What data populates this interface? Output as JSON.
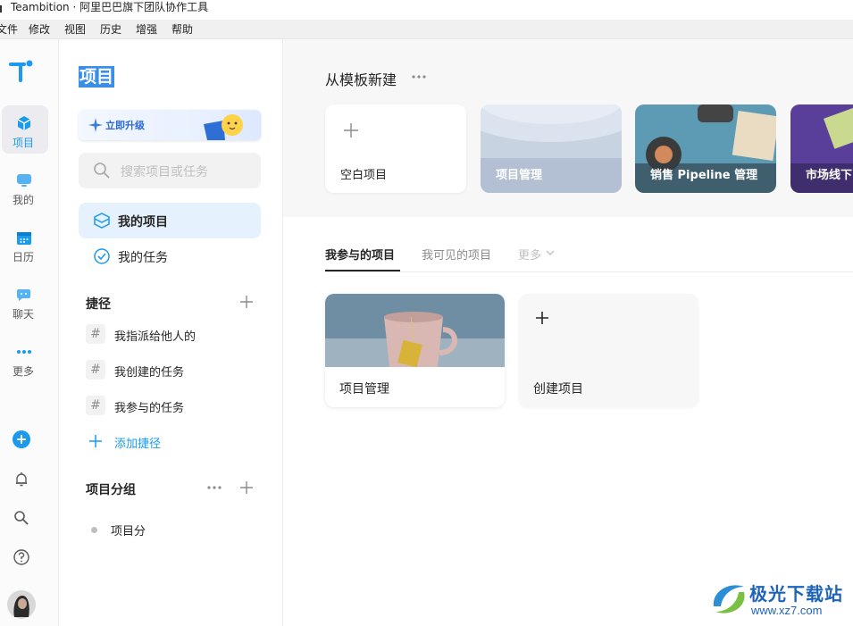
{
  "window": {
    "title": "Teambition · 阿里巴巴旗下团队协作工具"
  },
  "menu": [
    "文件",
    "修改",
    "视图",
    "历史",
    "增强",
    "帮助"
  ],
  "rail": {
    "items": [
      {
        "label": "项目",
        "icon": "project-cube-icon",
        "active": true
      },
      {
        "label": "我的",
        "icon": "my-monitor-icon"
      },
      {
        "label": "日历",
        "icon": "calendar-icon"
      },
      {
        "label": "聊天",
        "icon": "chat-bubble-icon"
      },
      {
        "label": "更多",
        "icon": "more-dots-icon"
      }
    ],
    "bottom_icons": [
      "add-icon",
      "bell-icon",
      "search-icon",
      "help-icon",
      "avatar"
    ]
  },
  "sidebar": {
    "title": "项目",
    "upgrade_label": "立即升级",
    "search_placeholder": "搜索项目或任务",
    "nav": [
      {
        "label": "我的项目",
        "active": true
      },
      {
        "label": "我的任务"
      }
    ],
    "shortcuts": {
      "heading": "捷径",
      "items": [
        "我指派给他人的",
        "我创建的任务",
        "我参与的任务"
      ],
      "add_label": "添加捷径"
    },
    "groups": {
      "heading": "项目分组",
      "items": [
        "项目分"
      ]
    }
  },
  "main": {
    "templates": {
      "heading": "从模板新建",
      "cards": [
        "空白项目",
        "项目管理",
        "销售 Pipeline 管理",
        "市场线下"
      ]
    },
    "tabs": [
      "我参与的项目",
      "我可见的项目"
    ],
    "tabs_more": "更多",
    "projects": [
      {
        "name": "项目管理"
      },
      {
        "name": "创建项目"
      }
    ]
  },
  "watermark": {
    "title": "极光下载站",
    "url": "www.xz7.com"
  },
  "colors": {
    "accent": "#1b9aee",
    "active_bg": "#e5f1fd",
    "rail_active_bg": "#ececf0"
  }
}
